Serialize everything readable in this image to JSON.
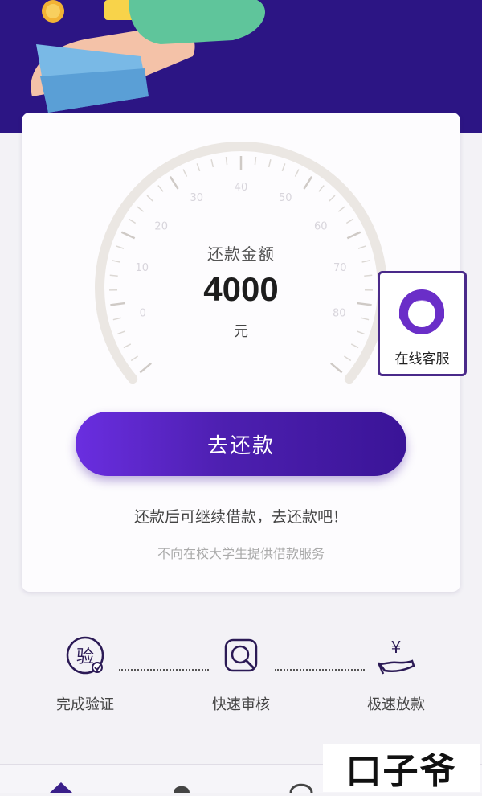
{
  "colors": {
    "hero_background": "#2c1584",
    "primary_gradient_start": "#6a2ee0",
    "primary_gradient_end": "#3a1497",
    "accent_purple": "#4a2a8a"
  },
  "gauge": {
    "tick_labels": [
      "0",
      "10",
      "20",
      "30",
      "40",
      "50",
      "60",
      "70",
      "80"
    ]
  },
  "repayment": {
    "label": "还款金额",
    "amount": "4000",
    "unit": "元"
  },
  "actions": {
    "repay_button": "去还款"
  },
  "messages": {
    "hint": "还款后可继续借款，去还款吧！",
    "note": "不向在校大学生提供借款服务"
  },
  "customer_service": {
    "label": "在线客服",
    "icon": "headset-agent-icon"
  },
  "steps": [
    {
      "label": "完成验证",
      "icon": "verify-badge-icon",
      "glyph": "验"
    },
    {
      "label": "快速审核",
      "icon": "review-magnifier-icon"
    },
    {
      "label": "极速放款",
      "icon": "yen-hand-icon",
      "glyph": "¥"
    }
  ],
  "watermark": {
    "text": "口子爷"
  }
}
